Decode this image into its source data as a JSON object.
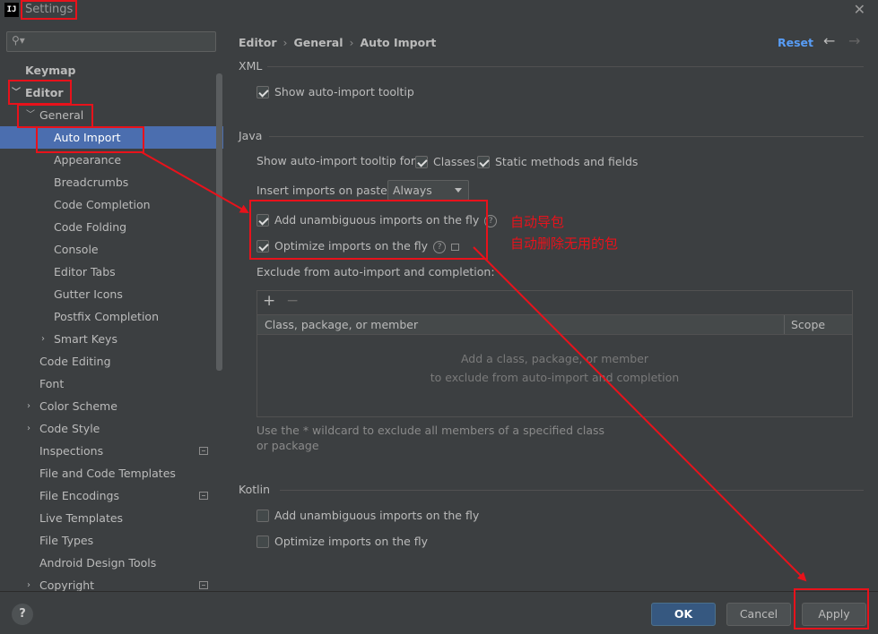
{
  "window": {
    "title": "Settings",
    "app_icon": "IJ"
  },
  "search": {
    "placeholder": ""
  },
  "sidebar": {
    "items": [
      {
        "label": "Keymap"
      },
      {
        "label": "Editor"
      },
      {
        "label": "General"
      },
      {
        "label": "Auto Import"
      },
      {
        "label": "Appearance"
      },
      {
        "label": "Breadcrumbs"
      },
      {
        "label": "Code Completion"
      },
      {
        "label": "Code Folding"
      },
      {
        "label": "Console"
      },
      {
        "label": "Editor Tabs"
      },
      {
        "label": "Gutter Icons"
      },
      {
        "label": "Postfix Completion"
      },
      {
        "label": "Smart Keys"
      },
      {
        "label": "Code Editing"
      },
      {
        "label": "Font"
      },
      {
        "label": "Color Scheme"
      },
      {
        "label": "Code Style"
      },
      {
        "label": "Inspections"
      },
      {
        "label": "File and Code Templates"
      },
      {
        "label": "File Encodings"
      },
      {
        "label": "Live Templates"
      },
      {
        "label": "File Types"
      },
      {
        "label": "Android Design Tools"
      },
      {
        "label": "Copyright"
      }
    ]
  },
  "header": {
    "breadcrumb": [
      "Editor",
      "General",
      "Auto Import"
    ],
    "reset_label": "Reset"
  },
  "xml": {
    "title": "XML",
    "show_tooltip_label": "Show auto-import tooltip",
    "show_tooltip_checked": true
  },
  "java": {
    "title": "Java",
    "tooltip_for_label": "Show auto-import tooltip for:",
    "classes_label": "Classes",
    "classes_checked": true,
    "static_label": "Static methods and fields",
    "static_checked": true,
    "paste_label": "Insert imports on paste:",
    "paste_value": "Always",
    "add_unambiguous_label": "Add unambiguous imports on the fly",
    "add_unambiguous_checked": true,
    "optimize_label": "Optimize imports on the fly",
    "optimize_checked": true,
    "exclude_label": "Exclude from auto-import and completion:",
    "table": {
      "col1": "Class, package, or member",
      "col2": "Scope",
      "empty_line1": "Add a class, package, or member",
      "empty_line2": "to exclude from auto-import and completion"
    },
    "hint": "Use the * wildcard to exclude all members of a specified class or package"
  },
  "kotlin": {
    "title": "Kotlin",
    "add_unambiguous_label": "Add unambiguous imports on the fly",
    "add_unambiguous_checked": false,
    "optimize_label": "Optimize imports on the fly",
    "optimize_checked": false
  },
  "annotation": {
    "line1": "自动导包",
    "line2": "自动删除无用的包",
    "color": "#e8121b"
  },
  "footer": {
    "help_label": "?",
    "ok_label": "OK",
    "cancel_label": "Cancel",
    "apply_label": "Apply"
  },
  "colors": {
    "background": "#3c3f41",
    "selection": "#4b6eaf",
    "link": "#589df6",
    "primary_button": "#365880"
  }
}
